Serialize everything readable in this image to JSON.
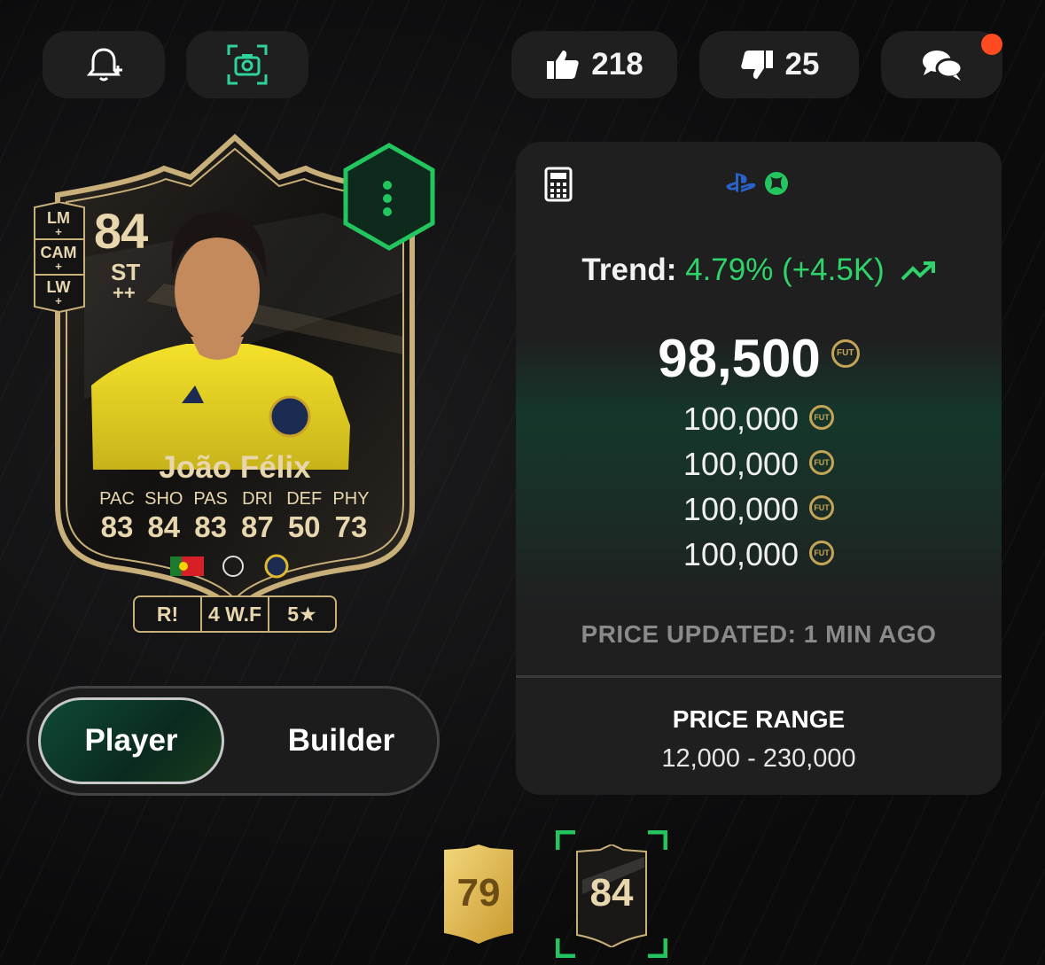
{
  "topbar": {
    "likes": "218",
    "dislikes": "25"
  },
  "card": {
    "rating": "84",
    "position": "ST",
    "position_plus": "++",
    "alt_positions": [
      {
        "pos": "LM",
        "plus": "+"
      },
      {
        "pos": "CAM",
        "plus": "+"
      },
      {
        "pos": "LW",
        "plus": "+"
      }
    ],
    "name": "João Félix",
    "stat_labels": [
      "PAC",
      "SHO",
      "PAS",
      "DRI",
      "DEF",
      "PHY"
    ],
    "stat_values": [
      "83",
      "84",
      "83",
      "87",
      "50",
      "73"
    ],
    "chips": [
      "R!",
      "4 W.F",
      "5★"
    ]
  },
  "toggle": {
    "active": "Player",
    "inactive": "Builder"
  },
  "price_panel": {
    "trend_label": "Trend:",
    "trend_value": "4.79% (+4.5K)",
    "price": "98,500",
    "other_prices": [
      "100,000",
      "100,000",
      "100,000",
      "100,000"
    ],
    "coin_label": "FUT",
    "updated": "PRICE UPDATED: 1 MIN AGO",
    "range_title": "PRICE RANGE",
    "range_value": "12,000 - 230,000"
  },
  "versions": [
    {
      "rating": "79"
    },
    {
      "rating": "84"
    }
  ],
  "colors": {
    "accent_green": "#2fd36a",
    "gold": "#e8d7ae",
    "notification": "#ff4b1f"
  }
}
